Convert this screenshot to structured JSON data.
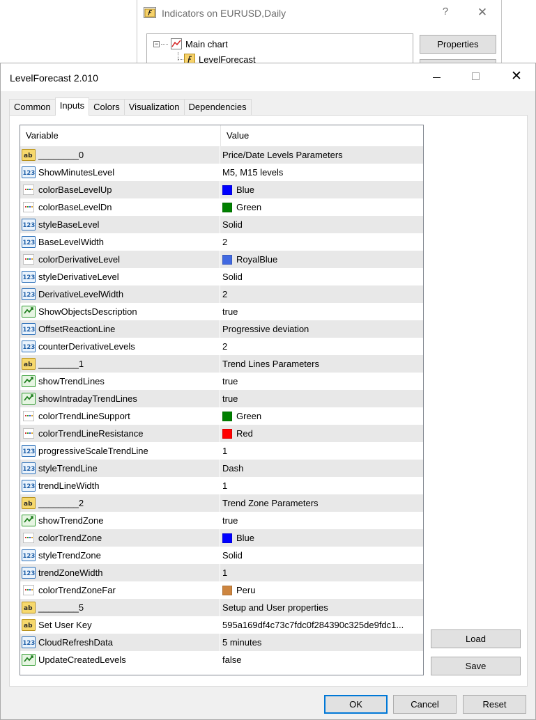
{
  "background_window": {
    "title": "Indicators on EURUSD,Daily",
    "help_glyph": "?",
    "close_glyph": "✕",
    "tree": {
      "root_label": "Main chart",
      "expander": "−",
      "child_label": "LevelForecast"
    },
    "properties_label": "Properties"
  },
  "dialog": {
    "title": "LevelForecast 2.010",
    "close_glyph": "✕",
    "tabs": [
      {
        "label": "Common",
        "active": false
      },
      {
        "label": "Inputs",
        "active": true
      },
      {
        "label": "Colors",
        "active": false
      },
      {
        "label": "Visualization",
        "active": false
      },
      {
        "label": "Dependencies",
        "active": false
      }
    ],
    "grid": {
      "header_variable": "Variable",
      "header_value": "Value",
      "rows": [
        {
          "icon": "ab",
          "name": "________0",
          "value": "Price/Date Levels Parameters"
        },
        {
          "icon": "123",
          "name": "ShowMinutesLevel",
          "value": "M5, M15  levels"
        },
        {
          "icon": "color",
          "name": "colorBaseLevelUp",
          "value": "Blue",
          "color": "#0000ff"
        },
        {
          "icon": "color",
          "name": "colorBaseLevelDn",
          "value": "Green",
          "color": "#008000"
        },
        {
          "icon": "123",
          "name": "styleBaseLevel",
          "value": "Solid"
        },
        {
          "icon": "123",
          "name": "BaseLevelWidth",
          "value": "2"
        },
        {
          "icon": "color",
          "name": "colorDerivativeLevel",
          "value": "RoyalBlue",
          "color": "#4169e1"
        },
        {
          "icon": "123",
          "name": "styleDerivativeLevel",
          "value": "Solid"
        },
        {
          "icon": "123",
          "name": "DerivativeLevelWidth",
          "value": "2"
        },
        {
          "icon": "bool",
          "name": "ShowObjectsDescription",
          "value": "true"
        },
        {
          "icon": "123",
          "name": "OffsetReactionLine",
          "value": "Progressive deviation"
        },
        {
          "icon": "123",
          "name": "counterDerivativeLevels",
          "value": "2"
        },
        {
          "icon": "ab",
          "name": "________1",
          "value": "Trend Lines Parameters"
        },
        {
          "icon": "bool",
          "name": "showTrendLines",
          "value": "true"
        },
        {
          "icon": "bool",
          "name": "showIntradayTrendLines",
          "value": "true"
        },
        {
          "icon": "color",
          "name": "colorTrendLineSupport",
          "value": "Green",
          "color": "#008000"
        },
        {
          "icon": "color",
          "name": "colorTrendLineResistance",
          "value": "Red",
          "color": "#ff0000"
        },
        {
          "icon": "123",
          "name": "progressiveScaleTrendLine",
          "value": "1"
        },
        {
          "icon": "123",
          "name": "styleTrendLine",
          "value": "Dash"
        },
        {
          "icon": "123",
          "name": "trendLineWidth",
          "value": "1"
        },
        {
          "icon": "ab",
          "name": "________2",
          "value": "Trend Zone Parameters"
        },
        {
          "icon": "bool",
          "name": "showTrendZone",
          "value": "true"
        },
        {
          "icon": "color",
          "name": "colorTrendZone",
          "value": "Blue",
          "color": "#0000ff"
        },
        {
          "icon": "123",
          "name": "styleTrendZone",
          "value": "Solid"
        },
        {
          "icon": "123",
          "name": "trendZoneWidth",
          "value": "1"
        },
        {
          "icon": "color",
          "name": "colorTrendZoneFar",
          "value": "Peru",
          "color": "#cd853f"
        },
        {
          "icon": "ab",
          "name": "________5",
          "value": "Setup and User properties"
        },
        {
          "icon": "ab",
          "name": "Set User Key",
          "value": "595a169df4c73c7fdc0f284390c325de9fdc1..."
        },
        {
          "icon": "123",
          "name": "CloudRefreshData",
          "value": "5 minutes"
        },
        {
          "icon": "bool",
          "name": "UpdateCreatedLevels",
          "value": "false"
        }
      ]
    },
    "load_label": "Load",
    "save_label": "Save",
    "ok_label": "OK",
    "cancel_label": "Cancel",
    "reset_label": "Reset"
  },
  "icon_names": {
    "ab": "string-type-icon",
    "123": "integer-type-icon",
    "color": "color-type-icon",
    "bool": "boolean-type-icon"
  },
  "colors": {
    "accent": "#0078d7",
    "string_icon_fill": "#f5d76e",
    "int_icon_stroke": "#1e6fb5",
    "bool_icon_fill": "#3aa935"
  }
}
